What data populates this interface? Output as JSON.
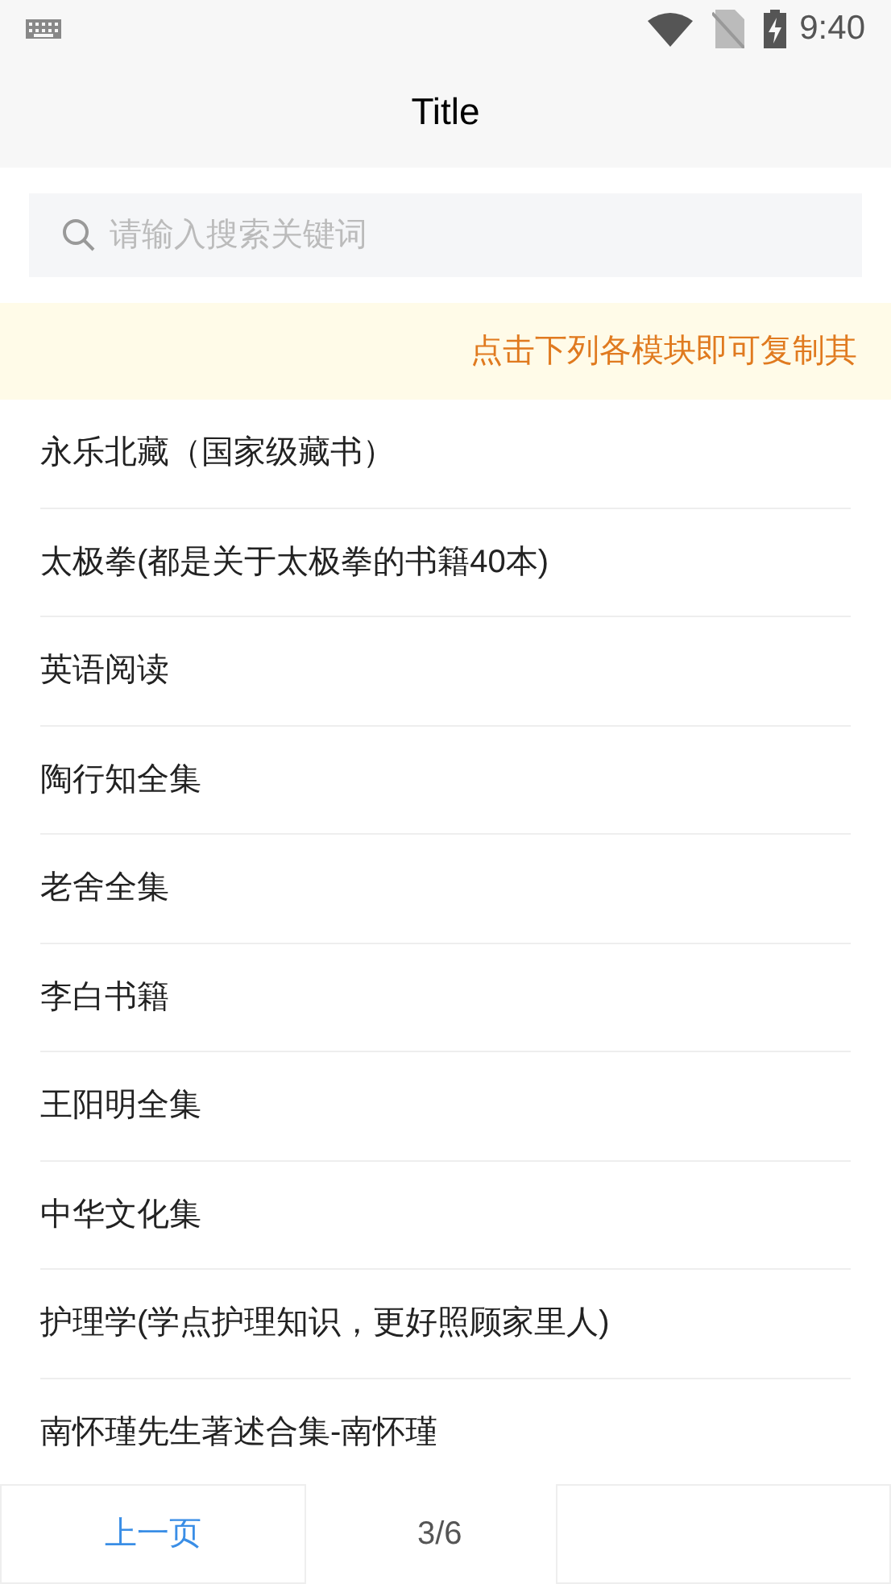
{
  "status_bar": {
    "time": "9:40"
  },
  "title": "Title",
  "search": {
    "placeholder": "请输入搜索关键词"
  },
  "notice": "点击下列各模块即可复制其",
  "items": [
    {
      "label": "永乐北藏（国家级藏书）"
    },
    {
      "label": "太极拳(都是关于太极拳的书籍40本)"
    },
    {
      "label": "英语阅读"
    },
    {
      "label": "陶行知全集"
    },
    {
      "label": "老舍全集"
    },
    {
      "label": "李白书籍"
    },
    {
      "label": "王阳明全集"
    },
    {
      "label": "中华文化集"
    },
    {
      "label": "护理学(学点护理知识，更好照顾家里人)"
    },
    {
      "label": "南怀瑾先生著述合集-南怀瑾"
    }
  ],
  "pager": {
    "prev": "上一页",
    "page": "3/6"
  }
}
